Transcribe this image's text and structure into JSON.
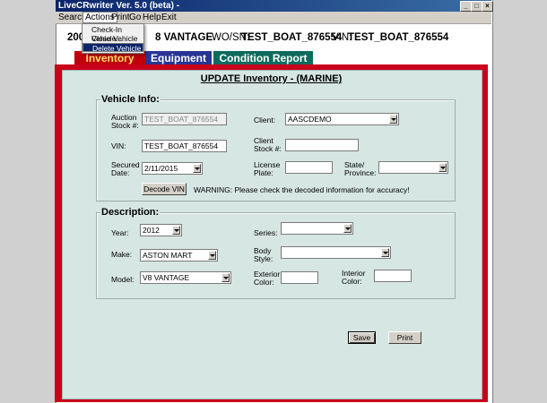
{
  "window": {
    "title": "LiveCRwriter Ver. 5.0 (beta) -"
  },
  "menu": {
    "items": [
      "Search",
      "Actions",
      "Print",
      "Go",
      "Help",
      "Exit"
    ]
  },
  "actions_menu": {
    "items": [
      "Check-In Vehicle...",
      "Close Vehicle",
      "Delete Vehicle"
    ],
    "selected": "Delete Vehicle"
  },
  "header": {
    "year_frag": "200",
    "model_frag": "8 VANTAGE",
    "wo_label": "WO/SN:",
    "wo_value": "TEST_BOAT_876554",
    "vin_label": "VIN:",
    "vin_value": "TEST_BOAT_876554"
  },
  "tabs": [
    {
      "label": "Inventory",
      "active": true
    },
    {
      "label": "Equipment"
    },
    {
      "label": "Condition Report"
    }
  ],
  "page_title": "UPDATE Inventory - (MARINE)",
  "vehicle_info": {
    "title": "Vehicle Info:",
    "auction_stock_label": "Auction Stock #:",
    "auction_stock_value": "TEST_BOAT_876554",
    "client_label": "Client:",
    "client_value": "AASCDEMO",
    "vin_label": "VIN:",
    "vin_value": "TEST_BOAT_876554",
    "client_stock_label": "Client Stock #:",
    "client_stock_value": "",
    "secured_date_label": "Secured Date:",
    "secured_date_value": "2/11/2015",
    "license_plate_label": "License Plate:",
    "license_plate_value": "",
    "state_label": "State/ Province:",
    "state_value": "",
    "decode_button": "Decode VIN",
    "warning": "WARNING: Please check the decoded information for accuracy!"
  },
  "description": {
    "title": "Description:",
    "year_label": "Year:",
    "year_value": "2012",
    "series_label": "Series:",
    "series_value": "",
    "make_label": "Make:",
    "make_value": "ASTON MART",
    "body_style_label": "Body Style:",
    "body_style_value": "",
    "model_label": "Model:",
    "model_value": "V8 VANTAGE",
    "exterior_color_label": "Exterior Color:",
    "exterior_color_value": "",
    "interior_color_label": "Interior Color:",
    "interior_color_value": ""
  },
  "buttons": {
    "save": "Save",
    "print": "Print"
  }
}
